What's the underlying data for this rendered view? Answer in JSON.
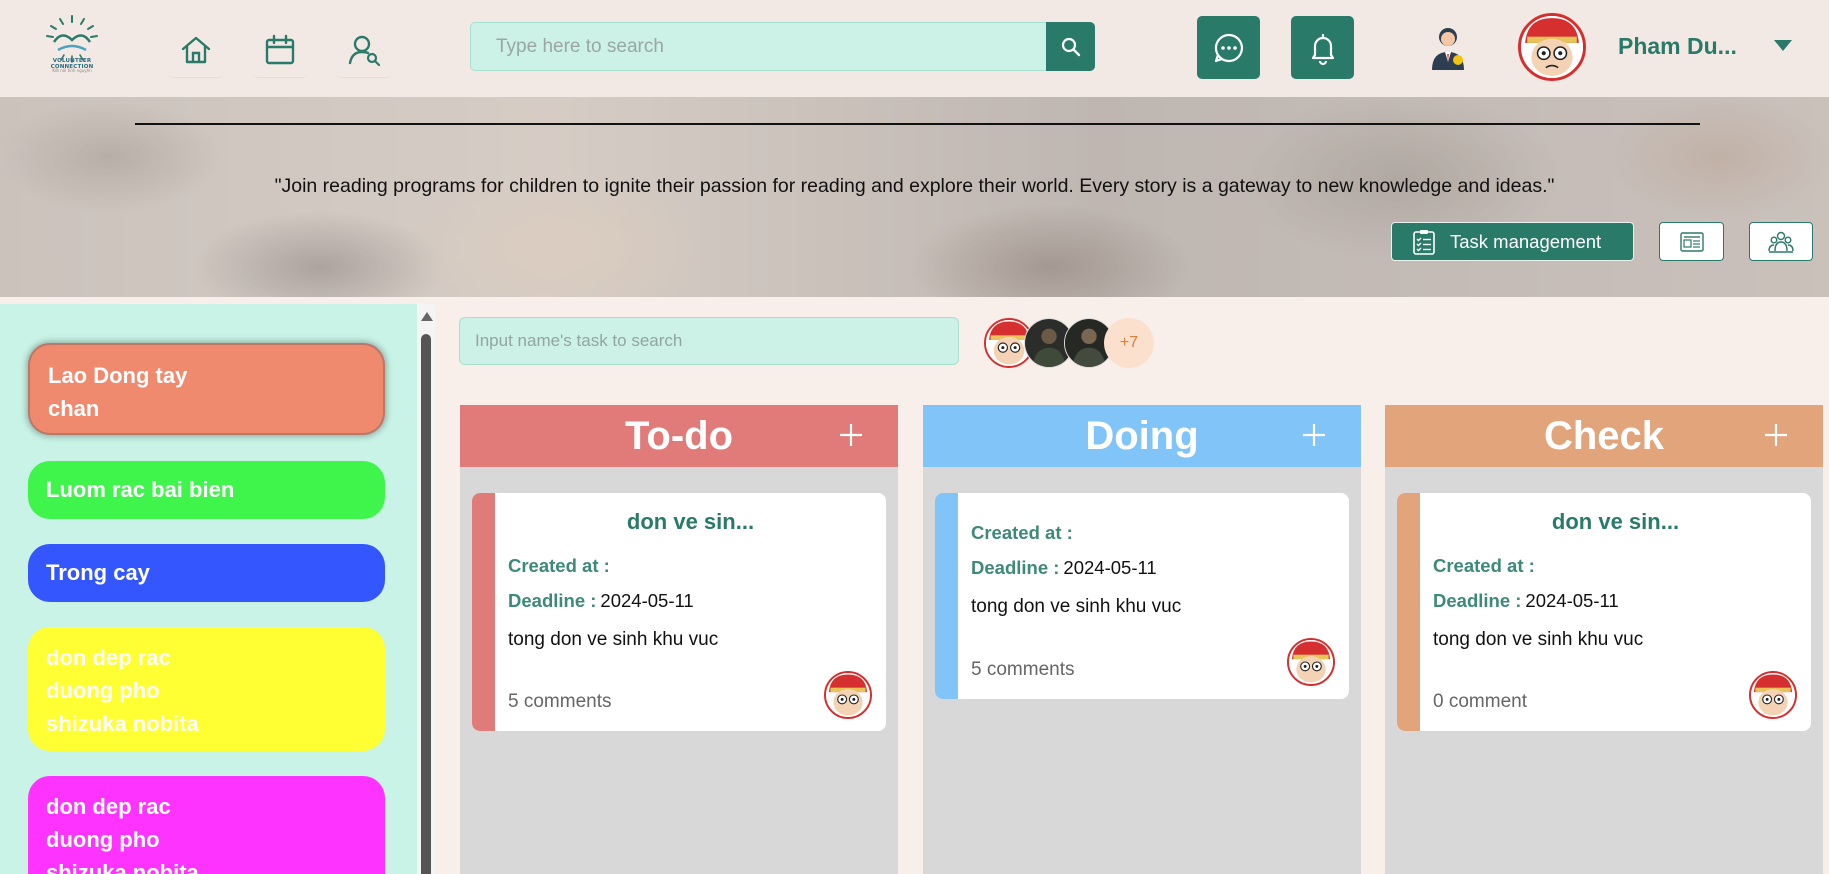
{
  "header": {
    "logo_name": "VOLUNTEER CONNECTION",
    "logo_tagline": "Kết nối tình nguyện",
    "search_placeholder": "Type here to search",
    "user_name": "Pham Du...",
    "brand_color": "#2a7a6a"
  },
  "banner": {
    "quote": "\"Join reading programs for children to ignite their passion for reading and explore their world. Every story is a gateway to new knowledge and ideas.\"",
    "task_management_label": "Task management"
  },
  "sidebar": {
    "projects": [
      {
        "label": "Lao Dong tay\nchan",
        "color": "#ef8a6f",
        "active": true
      },
      {
        "label": "Luom rac bai bien",
        "color": "#3ff54b",
        "active": false
      },
      {
        "label": "Trong cay",
        "color": "#3456ff",
        "active": false
      },
      {
        "label": "don dep rac\nduong pho\nshizuka nobita",
        "color": "#ffff33",
        "active": false
      },
      {
        "label": "don dep rac\nduong pho\nshizuka nobita",
        "color": "#ff33ff",
        "active": false
      }
    ]
  },
  "main": {
    "task_search_placeholder": "Input name's task to search",
    "members_more": "+7",
    "columns": [
      {
        "title": "To-do",
        "color": "#e07b79",
        "card": {
          "title": "don ve sin...",
          "created_label": "Created at :",
          "created_value": "",
          "deadline_label": "Deadline :",
          "deadline_value": "2024-05-11",
          "description": "tong don ve sinh khu vuc",
          "comments": "5 comments"
        }
      },
      {
        "title": "Doing",
        "color": "#80c4f8",
        "card": {
          "title": "",
          "created_label": "Created at :",
          "created_value": "",
          "deadline_label": "Deadline :",
          "deadline_value": "2024-05-11",
          "description": "tong don ve sinh khu vuc",
          "comments": "5 comments"
        }
      },
      {
        "title": "Check",
        "color": "#e2a47b",
        "card": {
          "title": "don ve sin...",
          "created_label": "Created at :",
          "created_value": "",
          "deadline_label": "Deadline :",
          "deadline_value": "2024-05-11",
          "description": "tong don ve sinh khu vuc",
          "comments": "0 comment"
        }
      }
    ]
  }
}
